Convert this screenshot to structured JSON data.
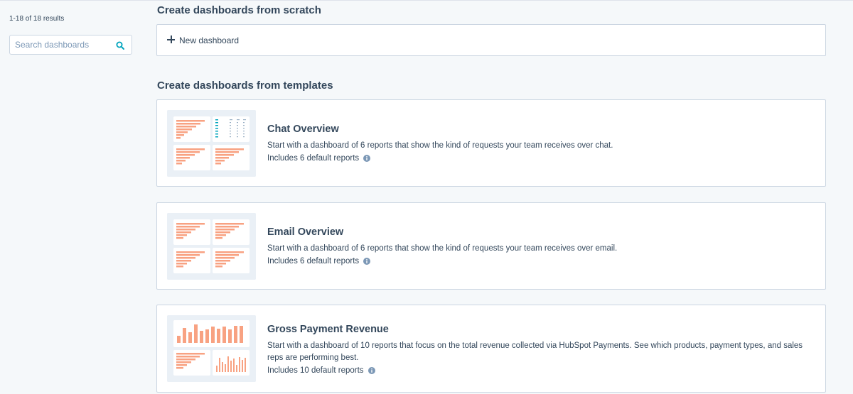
{
  "sidebar": {
    "results_count": "1-18 of 18 results",
    "search_placeholder": "Search dashboards",
    "search_value": ""
  },
  "scratch": {
    "heading": "Create dashboards from scratch",
    "new_dashboard_label": "New dashboard"
  },
  "templates": {
    "heading": "Create dashboards from templates",
    "items": [
      {
        "title": "Chat Overview",
        "description": "Start with a dashboard of 6 reports that show the kind of requests your team receives over chat.",
        "includes": "Includes 6 default reports"
      },
      {
        "title": "Email Overview",
        "description": "Start with a dashboard of 6 reports that show the kind of requests your team receives over email.",
        "includes": "Includes 6 default reports"
      },
      {
        "title": "Gross Payment Revenue",
        "description": "Start with a dashboard of 10 reports that focus on the total revenue collected via HubSpot Payments. See which products, payment types, and sales reps are performing best.",
        "includes": "Includes 10 default reports"
      }
    ]
  },
  "colors": {
    "accent": "#00a4bd",
    "bar": "#f8a282",
    "text": "#33475b",
    "border": "#cbd6e2",
    "background": "#f5f8fa"
  },
  "icons": [
    "search-icon",
    "plus-icon",
    "info-icon"
  ]
}
